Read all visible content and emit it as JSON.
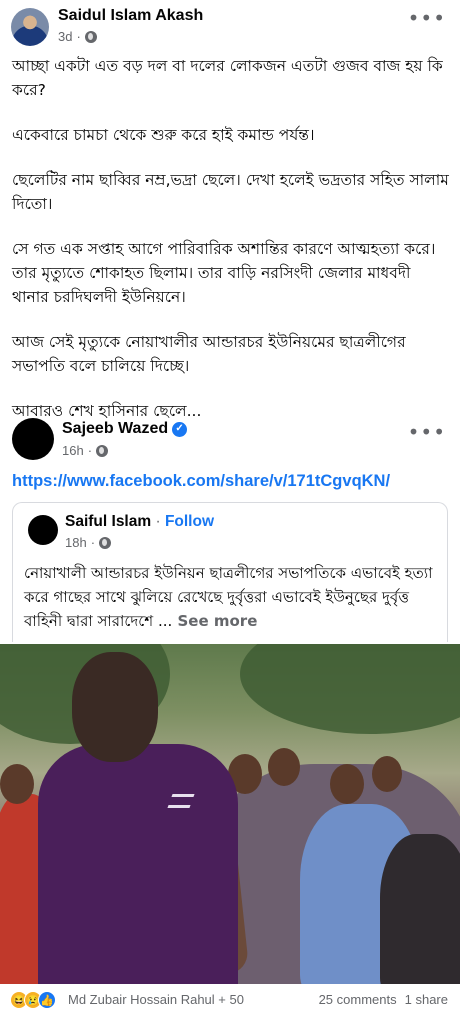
{
  "post": {
    "author": "Saidul Islam Akash",
    "time": "3d",
    "more_label": "•••",
    "paragraphs": [
      "আচ্ছা একটা এত বড় দল বা দলের লোকজন  এতটা গুজব বাজ হয় কি করে?",
      "একেবারে চামচা থেকে শুরু করে  হাই কমান্ড পর্যন্ত।",
      "ছেলেটির নাম ছাব্বির নম্র,ভদ্রা ছেলে। দেখা হলেই ভদ্রতার সহিত সালাম দিতো।",
      "সে গত এক সপ্তাহ আগে পারিবারিক অশান্তির  কারণে আত্মহত্যা করে। তার মৃত্যুতে শোকাহত ছিলাম। তার বাড়ি নরসিংদী জেলার মাধবদী থানার চরদিঘলদী ইউনিয়নে।",
      "আজ সেই মৃত্যুকে নোয়াখালীর আন্ডারচর ইউনিয়মের ছাত্রলীগের সভাপতি বলে চালিয়ে দিচ্ছে।",
      "আবারও শেখ হাসিনার ছেলে..."
    ]
  },
  "shared_post": {
    "author": "Sajeeb Wazed",
    "time": "16h",
    "more_label": "•••",
    "link": "https://www.facebook.com/share/v/171tCgvqKN/"
  },
  "embedded_post": {
    "author": "Saiful Islam",
    "separator": " · ",
    "follow_label": "Follow",
    "time": "18h",
    "text": "নোয়াখালী আন্ডারচর ইউনিয়ন ছাত্রলীগের সভাপতিকে এভাবেই হত্যা করে গাছের সাথে ঝুলিয়ে রেখেছে দুর্বৃত্তরা এভাবেই ইউনুছের দুর্বৃত্ত বাহিনী দ্বারা সারাদেশে ...",
    "see_more_label": " See more"
  },
  "reactions": {
    "icons": [
      "haha-icon",
      "sad-icon",
      "like-icon"
    ],
    "names": "Md Zubair Hossain Rahul + 50",
    "comments": "25 comments",
    "shares": "1 share"
  },
  "colors": {
    "link_blue": "#1877f2",
    "meta_gray": "#65676b",
    "text": "#050505"
  }
}
